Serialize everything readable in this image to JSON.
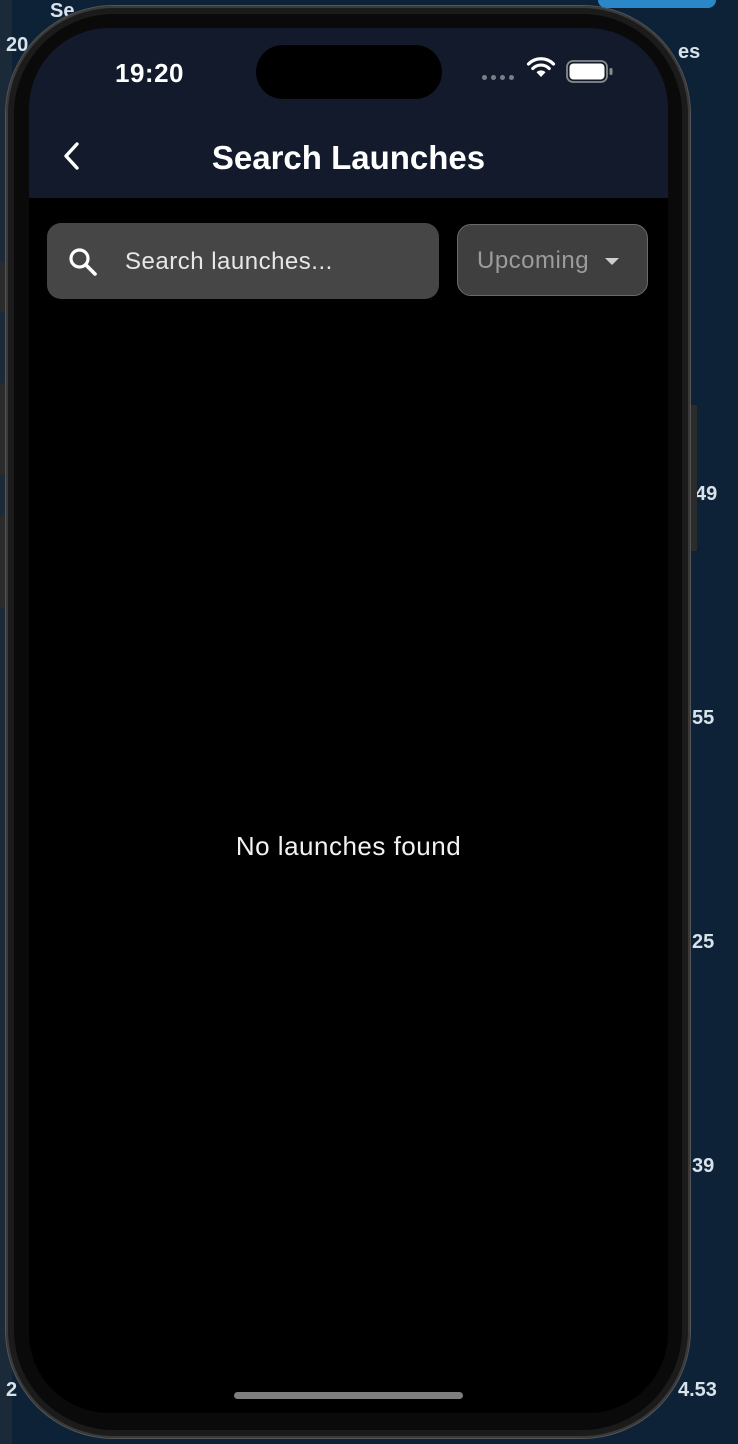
{
  "background": {
    "fragments": [
      "Se",
      "20",
      "es",
      "49",
      "55",
      "25",
      "39",
      "2",
      "4.53"
    ]
  },
  "status_bar": {
    "time": "19:20"
  },
  "nav": {
    "title": "Search Launches"
  },
  "search": {
    "placeholder": "Search launches..."
  },
  "filter": {
    "selected": "Upcoming"
  },
  "empty_state": {
    "message": "No launches found"
  },
  "colors": {
    "header_bg": "#121a2c",
    "screen_bg": "#000000",
    "search_bg": "#464646",
    "filter_bg": "#3f3f3f"
  }
}
